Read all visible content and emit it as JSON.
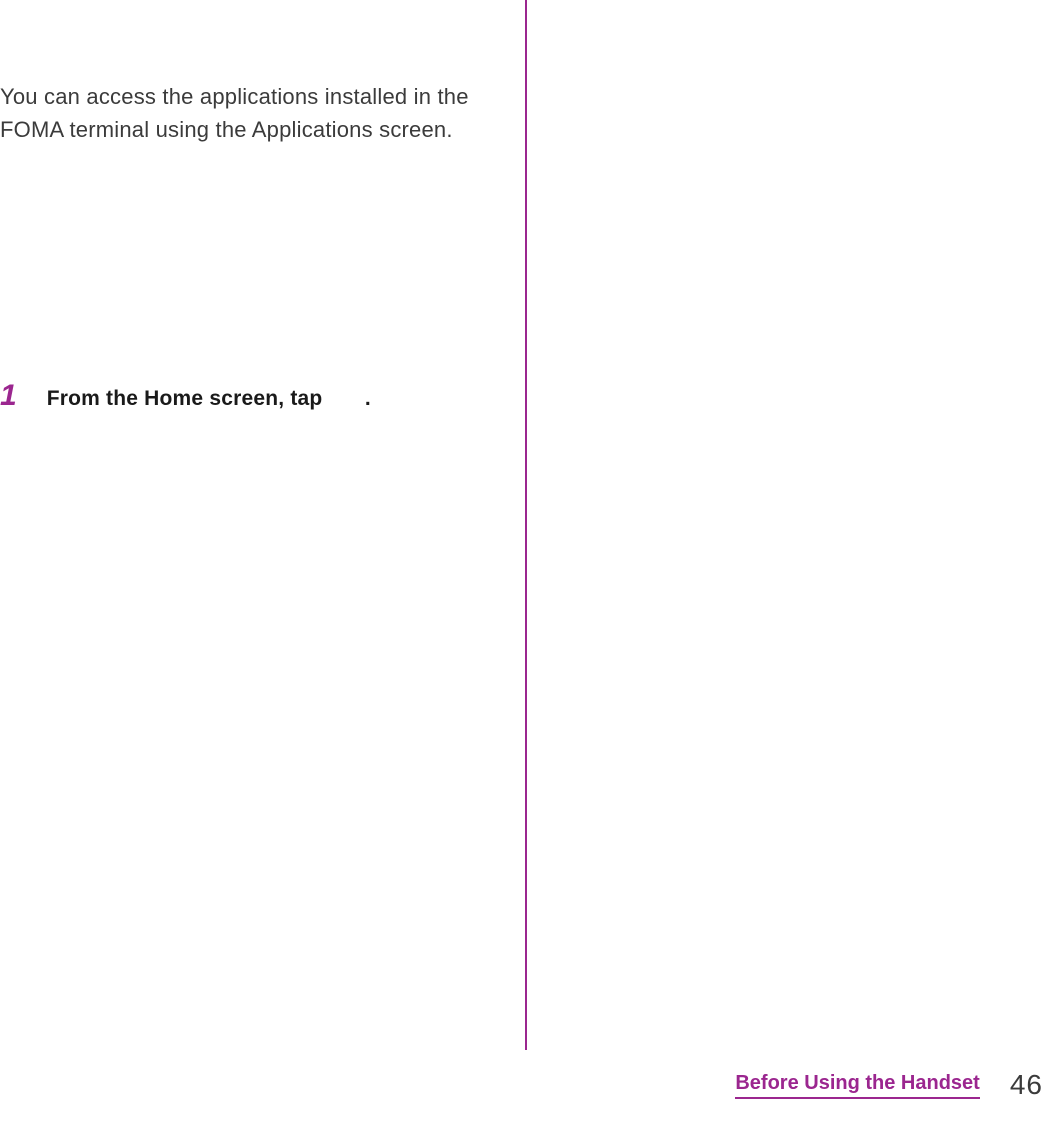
{
  "intro_text": "You can access the applications installed in the FOMA terminal using the Applications screen.",
  "step": {
    "number": "1",
    "text": "From the Home screen, tap  ."
  },
  "footer": {
    "section": "Before Using the Handset",
    "page": "46"
  }
}
